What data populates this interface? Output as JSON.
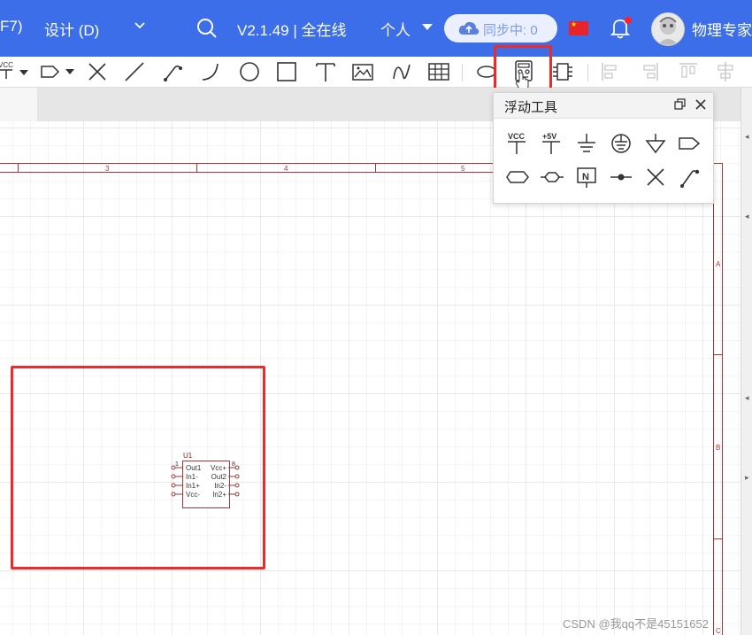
{
  "header": {
    "menu_partial": "F7)",
    "design_menu": "设计 (D)",
    "version": "V2.1.49 | 全在线",
    "workspace": "个人",
    "sync_status": "同步中: 0",
    "username": "物理专家"
  },
  "float_panel": {
    "title": "浮动工具",
    "tools_row1": [
      "vcc-power",
      "plus5v-power",
      "ground",
      "circle-ground",
      "arrow-ground",
      "netlabel-out"
    ],
    "tools_row2": [
      "netlabel-bidir",
      "netlabel-port",
      "no-connect-flag",
      "net-point",
      "no-connect",
      "wire-probe"
    ],
    "vcc_label": "VCC",
    "plus5v_label": "+5V"
  },
  "toolbar": {
    "vcc_partial": "VCC",
    "highlighted_tool": "floating-tools"
  },
  "schematic": {
    "ruler_numbers": [
      "3",
      "4",
      "5"
    ],
    "right_ruler_letters": [
      "A",
      "B",
      "C"
    ],
    "component": {
      "ref": "U1",
      "pin1": "1",
      "pin8": "8",
      "left_pins": [
        "Out1",
        "In1-",
        "In1+",
        "Vcc-"
      ],
      "right_pins": [
        "Vcc+",
        "Out2",
        "In2-",
        "In2+"
      ]
    }
  },
  "watermark": "CSDN @我qq不是45151652",
  "colors": {
    "header_bg": "#3b6ee8",
    "highlight": "#ee2a2a",
    "sheet_border": "#9b3a3a"
  }
}
